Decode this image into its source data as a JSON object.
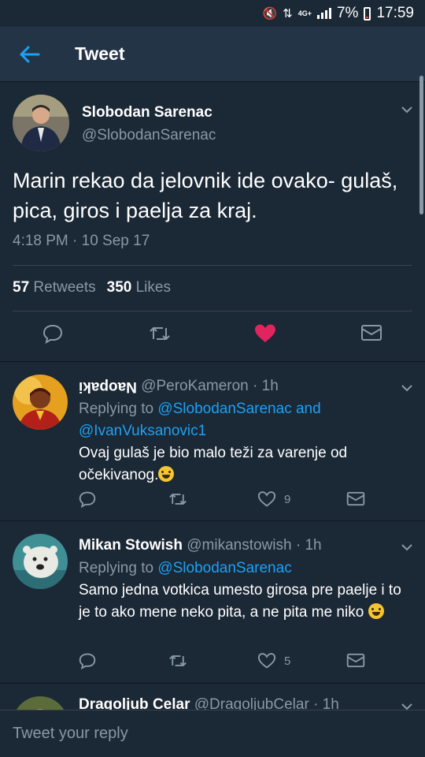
{
  "status_bar": {
    "network": "4G+",
    "battery": "7%",
    "time": "17:59"
  },
  "header": {
    "title": "Tweet"
  },
  "tweet": {
    "name": "Slobodan Sarenac",
    "handle": "@SlobodanSarenac",
    "text": "Marin rekao da jelovnik ide ovako- gulaš, pica, giros i paelja za kraj.",
    "time": "4:18 PM · 10 Sep 17",
    "retweets_count": "57",
    "retweets_label": "Retweets",
    "likes_count": "350",
    "likes_label": "Likes",
    "liked": true,
    "like_color": "#e0245e"
  },
  "replies": [
    {
      "name": "Naopaki",
      "handle": "@PeroKameron",
      "time": "· 1h",
      "replying_prefix": "Replying to",
      "mention_1": "@SlobodanSarenac",
      "connector": "and",
      "mention_2": "@IvanVuksanovic1",
      "text": "Ovaj gulaš je bio malo teži za varenje od očekivanog.",
      "emoji": "grinning-sweat-face",
      "likes": "9"
    },
    {
      "name": "Mikan Stowish",
      "handle": "@mikanstowish",
      "time": "· 1h",
      "replying_prefix": "Replying to",
      "mention_1": "@SlobodanSarenac",
      "text": "Samo jedna votkica umesto girosa pre paelje i to je to ako mene neko pita, a ne pita me niko",
      "emoji": "smiling-face",
      "likes": "5"
    },
    {
      "name": "Dragoljub Celar",
      "handle": "@DragoljubCelar",
      "time": "· 1h"
    }
  ],
  "reply_input": {
    "placeholder": "Tweet your reply"
  },
  "colors": {
    "background": "#1b2836",
    "header": "#243447",
    "accent": "#1da1f2",
    "muted": "#8899a6"
  }
}
